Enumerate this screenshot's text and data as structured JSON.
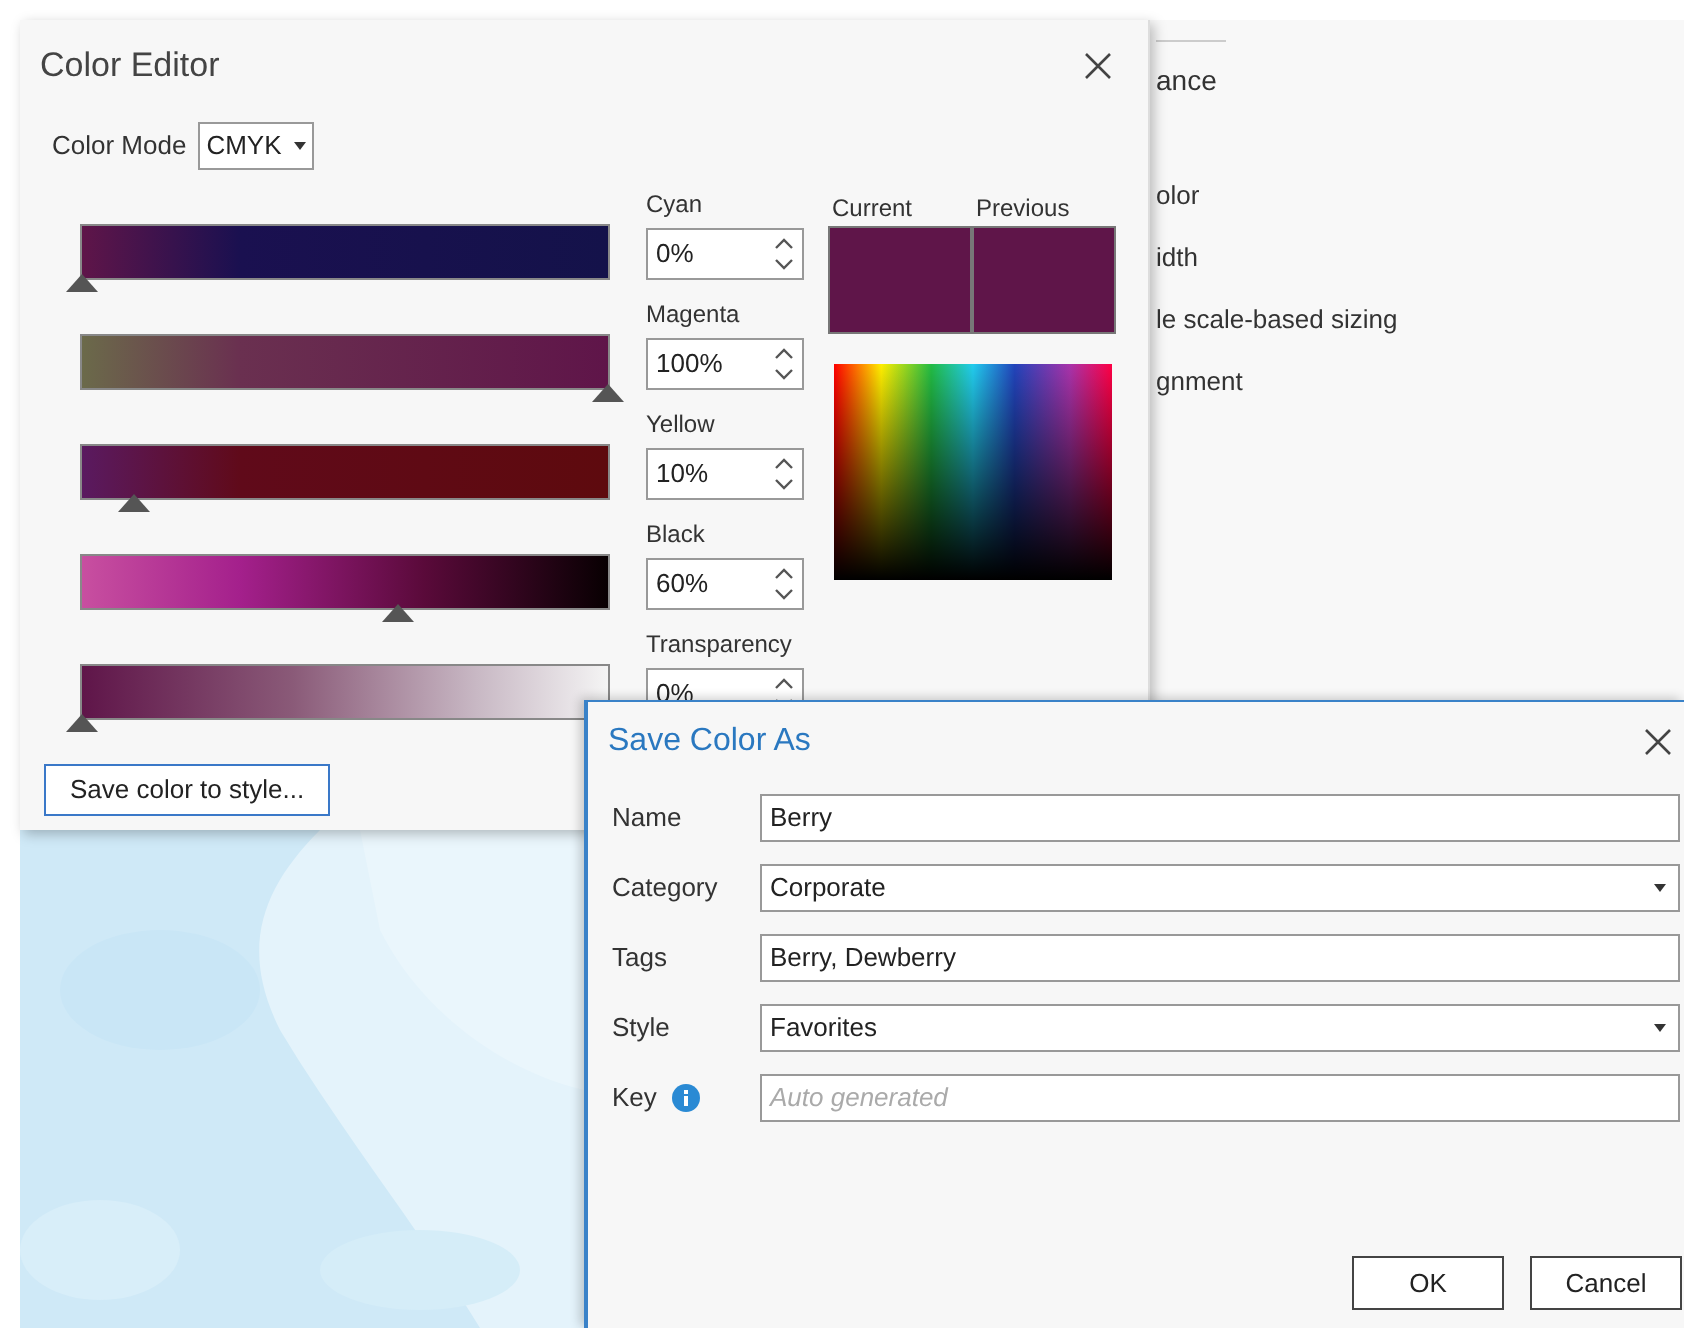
{
  "color_editor": {
    "title": "Color Editor",
    "mode_label": "Color Mode",
    "mode_value": "CMYK",
    "channels": [
      {
        "name": "Cyan",
        "value": "0%",
        "level": 0
      },
      {
        "name": "Magenta",
        "value": "100%",
        "level": 1
      },
      {
        "name": "Yellow",
        "value": "10%",
        "level": 0.1
      },
      {
        "name": "Black",
        "value": "60%",
        "level": 0.6
      },
      {
        "name": "Transparency",
        "value": "0%",
        "level": 0
      }
    ],
    "swatches": [
      {
        "label": "Current",
        "color": "#5f1549"
      },
      {
        "label": "Previous",
        "color": "#5f1549"
      }
    ],
    "save_button": "Save color to style..."
  },
  "background_panel": {
    "items": [
      "ance",
      "olor",
      "idth",
      "le scale-based sizing",
      "gnment"
    ]
  },
  "save_dialog": {
    "title": "Save Color As",
    "fields": [
      {
        "label": "Name",
        "kind": "text",
        "value": "Berry"
      },
      {
        "label": "Category",
        "kind": "select",
        "value": "Corporate"
      },
      {
        "label": "Tags",
        "kind": "text",
        "value": "Berry, Dewberry"
      },
      {
        "label": "Style",
        "kind": "select",
        "value": "Favorites"
      },
      {
        "label": "Key",
        "kind": "info_text",
        "placeholder": "Auto generated"
      }
    ],
    "buttons": [
      "OK",
      "Cancel"
    ]
  }
}
